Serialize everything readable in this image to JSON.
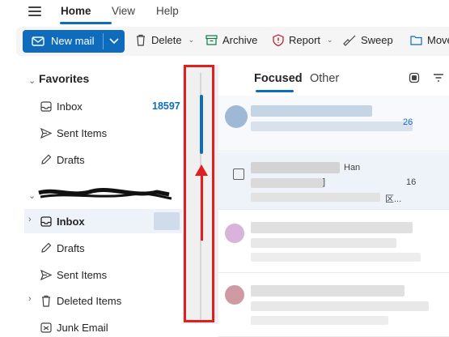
{
  "menu": {
    "tabs": [
      {
        "label": "Home"
      },
      {
        "label": "View"
      },
      {
        "label": "Help"
      }
    ]
  },
  "ribbon": {
    "new_mail": "New mail",
    "delete": "Delete",
    "archive": "Archive",
    "report": "Report",
    "sweep": "Sweep",
    "move": "Move"
  },
  "folders": {
    "favorites_title": "Favorites",
    "favorites": [
      {
        "label": "Inbox",
        "count": "18597",
        "icon": "inbox-icon"
      },
      {
        "label": "Sent Items",
        "icon": "send-icon"
      },
      {
        "label": "Drafts",
        "icon": "pencil-icon"
      }
    ],
    "account_items": [
      {
        "label": "Inbox",
        "icon": "inbox-icon"
      },
      {
        "label": "Drafts",
        "icon": "pencil-icon"
      },
      {
        "label": "Sent Items",
        "icon": "send-icon"
      },
      {
        "label": "Deleted Items",
        "icon": "trash-icon"
      },
      {
        "label": "Junk Email",
        "icon": "junk-icon"
      }
    ]
  },
  "message_list": {
    "tabs": [
      {
        "label": "Focused"
      },
      {
        "label": "Other"
      }
    ],
    "rows": [
      {
        "fragment_1": "26",
        "fragment_2": ""
      },
      {
        "fragment_1": "Han",
        "fragment_2": "16",
        "fragment_3": "]",
        "fragment_4": "区..."
      },
      {
        "fragment_1": "",
        "fragment_2": ""
      },
      {
        "fragment_1": "",
        "fragment_2": ""
      }
    ]
  },
  "colors": {
    "accent": "#0f6cbd",
    "annotation": "#e02020"
  }
}
